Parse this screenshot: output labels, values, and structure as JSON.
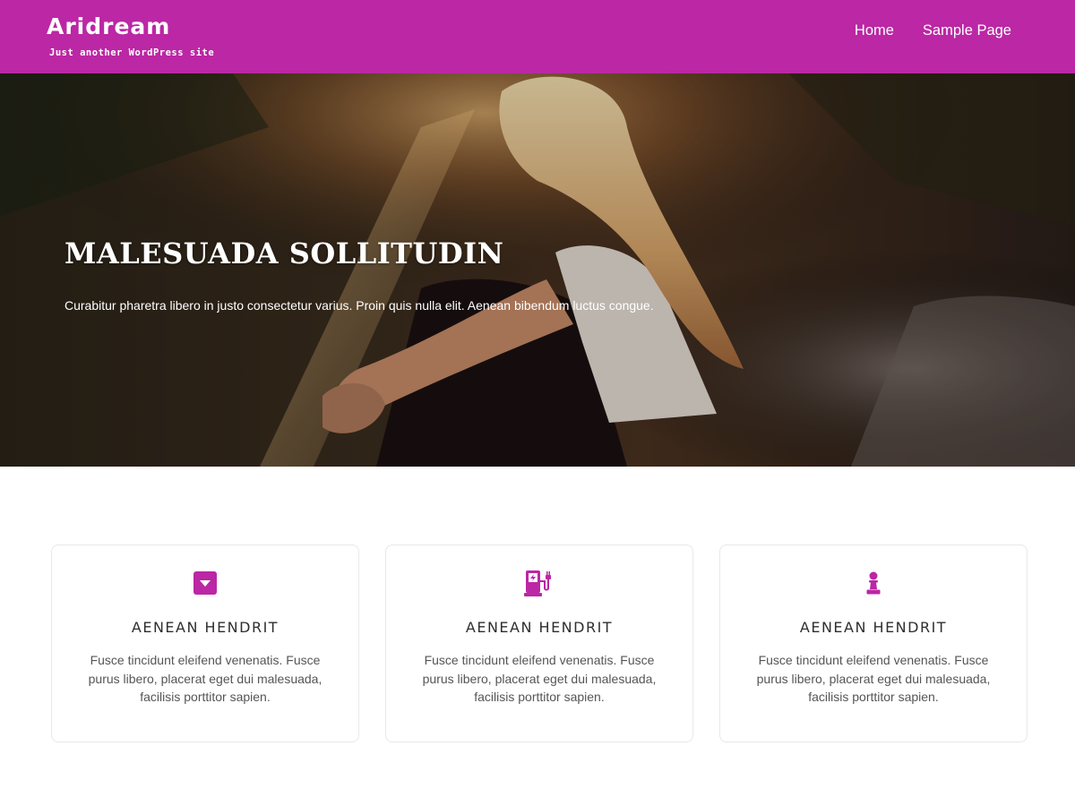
{
  "colors": {
    "accent": "#bb27a4",
    "hero_dark": "#1e1513",
    "card_border": "#e8e8e8"
  },
  "header": {
    "site_title": "Aridream",
    "tagline": "Just another WordPress site",
    "nav": [
      {
        "label": "Home"
      },
      {
        "label": "Sample Page"
      }
    ]
  },
  "hero": {
    "title": "MALESUADA SOLLITUDIN",
    "text": "Curabitur pharetra libero in justo consectetur varius. Proin quis nulla elit. Aenean bibendum luctus congue."
  },
  "features": [
    {
      "icon": "caret-square-down-icon",
      "title": "AENEAN HENDRIT",
      "text": "Fusce tincidunt eleifend venenatis. Fusce purus libero, placerat eget dui malesuada, facilisis porttitor sapien."
    },
    {
      "icon": "charging-station-icon",
      "title": "AENEAN HENDRIT",
      "text": "Fusce tincidunt eleifend venenatis. Fusce purus libero, placerat eget dui malesuada, facilisis porttitor sapien."
    },
    {
      "icon": "chess-pawn-icon",
      "title": "AENEAN HENDRIT",
      "text": "Fusce tincidunt eleifend venenatis. Fusce purus libero, placerat eget dui malesuada, facilisis porttitor sapien."
    }
  ]
}
